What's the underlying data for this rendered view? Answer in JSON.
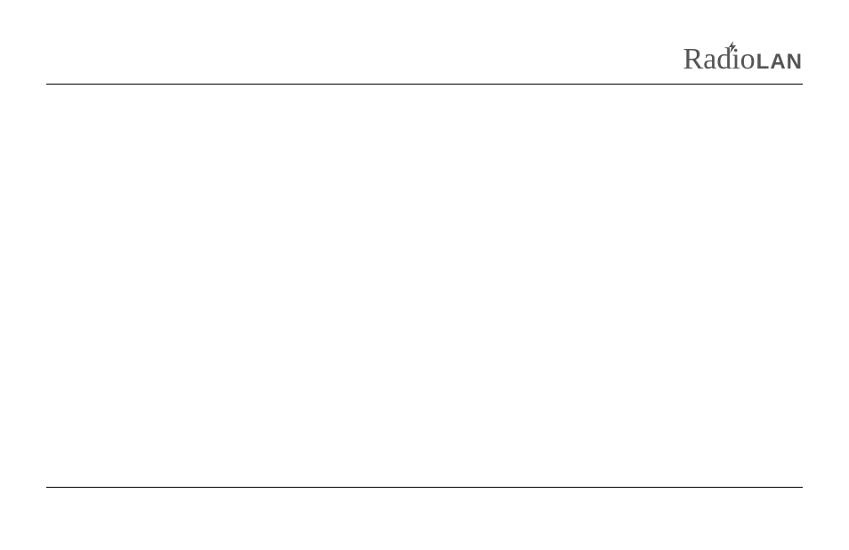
{
  "header": {
    "logo_left": "Radio",
    "logo_right": "LAN"
  }
}
